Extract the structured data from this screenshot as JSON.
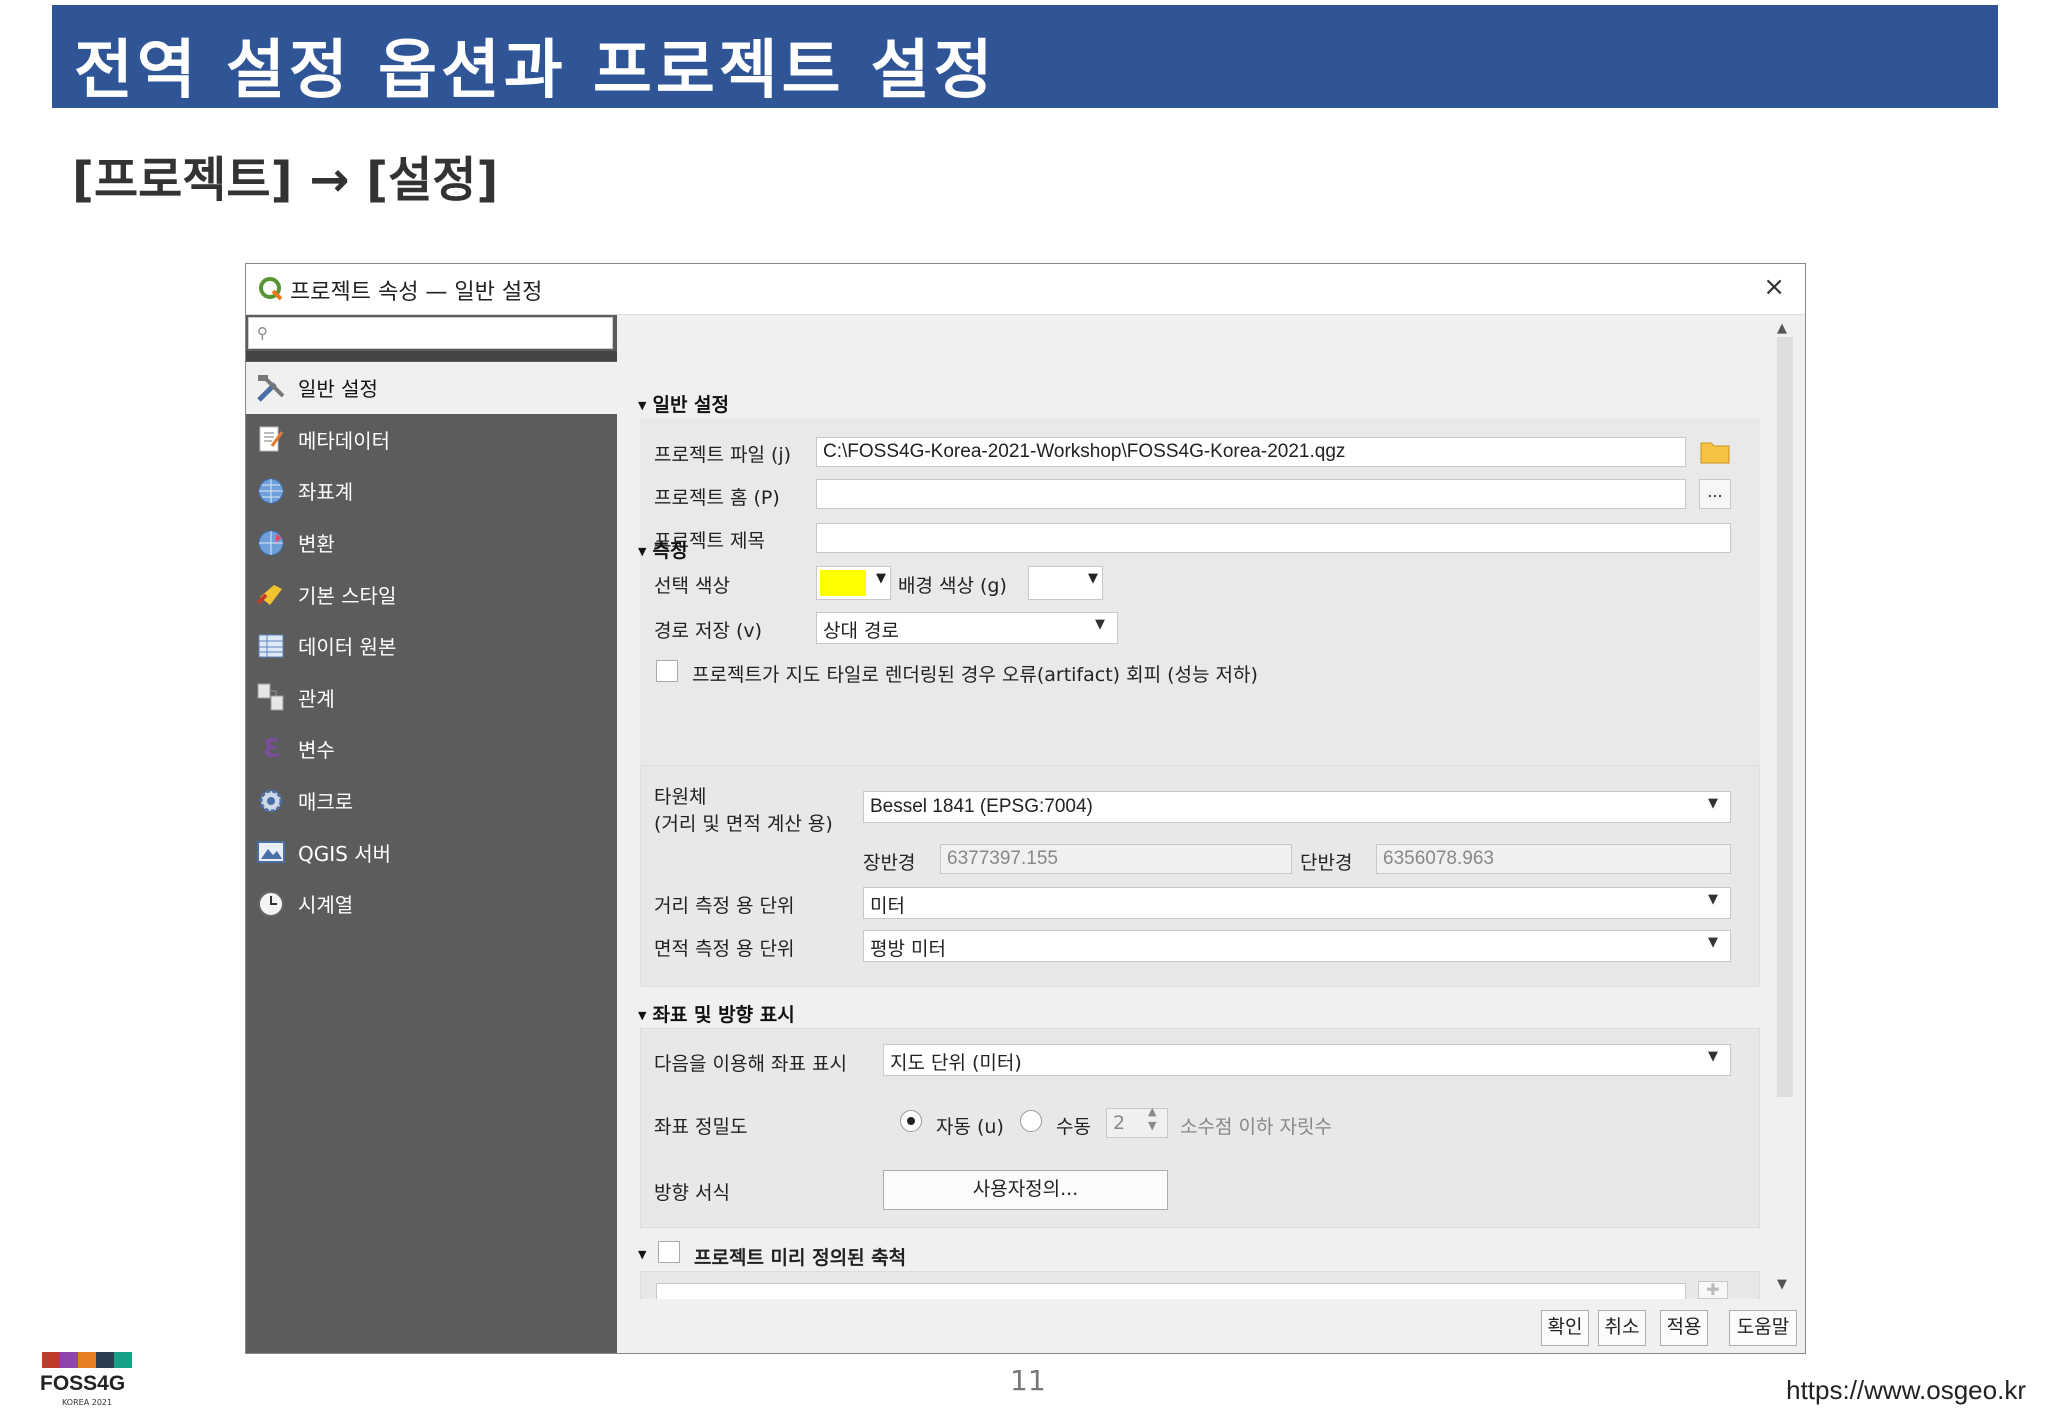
{
  "slide": {
    "title": "전역 설정 옵션과 프로젝트 설정",
    "subtitle": "[프로젝트] → [설정]",
    "page_number": "11",
    "url": "https://www.osgeo.kr",
    "logo_text": "FOSS4G",
    "logo_sub": "KOREA 2021"
  },
  "dialog": {
    "title": "프로젝트 속성 — 일반 설정",
    "close_label": "×",
    "search_placeholder": "",
    "nav": [
      {
        "label": "일반 설정",
        "icon": "tools-icon",
        "active": true
      },
      {
        "label": "메타데이터",
        "icon": "metadata-icon"
      },
      {
        "label": "좌표계",
        "icon": "globe-icon"
      },
      {
        "label": "변환",
        "icon": "transform-globe-icon"
      },
      {
        "label": "기본 스타일",
        "icon": "paint-brush-icon"
      },
      {
        "label": "데이터 원본",
        "icon": "table-icon"
      },
      {
        "label": "관계",
        "icon": "relations-icon"
      },
      {
        "label": "변수",
        "icon": "variable-icon"
      },
      {
        "label": "매크로",
        "icon": "gear-icon"
      },
      {
        "label": "QGIS 서버",
        "icon": "server-icon"
      },
      {
        "label": "시계열",
        "icon": "clock-icon"
      }
    ],
    "general": {
      "header": "일반 설정",
      "project_file_label": "프로젝트 파일 (j)",
      "project_file_value": "C:\\FOSS4G-Korea-2021-Workshop\\FOSS4G-Korea-2021.qgz",
      "project_home_label": "프로젝트 홈 (P)",
      "project_home_value": "",
      "browse_label": "...",
      "project_title_label": "프로젝트 제목",
      "project_title_value": "",
      "selection_color_label": "선택 색상",
      "selection_color": "#ffff00",
      "background_color_label": "배경 색상 (g)",
      "background_color": "#ffffff",
      "save_paths_label": "경로 저장 (v)",
      "save_paths_value": "상대 경로",
      "avoid_artifacts_label": "프로젝트가 지도 타일로 렌더링된 경우 오류(artifact) 회피 (성능 저하)"
    },
    "measure": {
      "header": "측정",
      "ellipsoid_label_1": "타원체",
      "ellipsoid_label_2": "(거리 및 면적 계산 용)",
      "ellipsoid_value": "Bessel 1841 (EPSG:7004)",
      "semi_major_label": "장반경",
      "semi_major_value": "6377397.155",
      "semi_minor_label": "단반경",
      "semi_minor_value": "6356078.963",
      "distance_units_label": "거리 측정 용 단위",
      "distance_units_value": "미터",
      "area_units_label": "면적 측정 용 단위",
      "area_units_value": "평방 미터"
    },
    "coordinate": {
      "header": "좌표 및 방향 표시",
      "display_label": "다음을 이용해 좌표 표시",
      "display_value": "지도 단위 (미터)",
      "precision_label": "좌표 정밀도",
      "auto_label": "자동 (u)",
      "manual_label": "수동",
      "manual_value": "2",
      "decimal_label": "소수점 이하 자릿수",
      "bearing_label": "방향 서식",
      "custom_button": "사용자정의..."
    },
    "scales": {
      "header": "프로젝트 미리 정의된 축척"
    },
    "buttons": {
      "ok": "확인",
      "cancel": "취소",
      "apply": "적용",
      "help": "도움말"
    }
  },
  "colors": {
    "banner": "#2f5597",
    "sidebar": "#5c5c5c",
    "qgis_green": "#589632"
  }
}
